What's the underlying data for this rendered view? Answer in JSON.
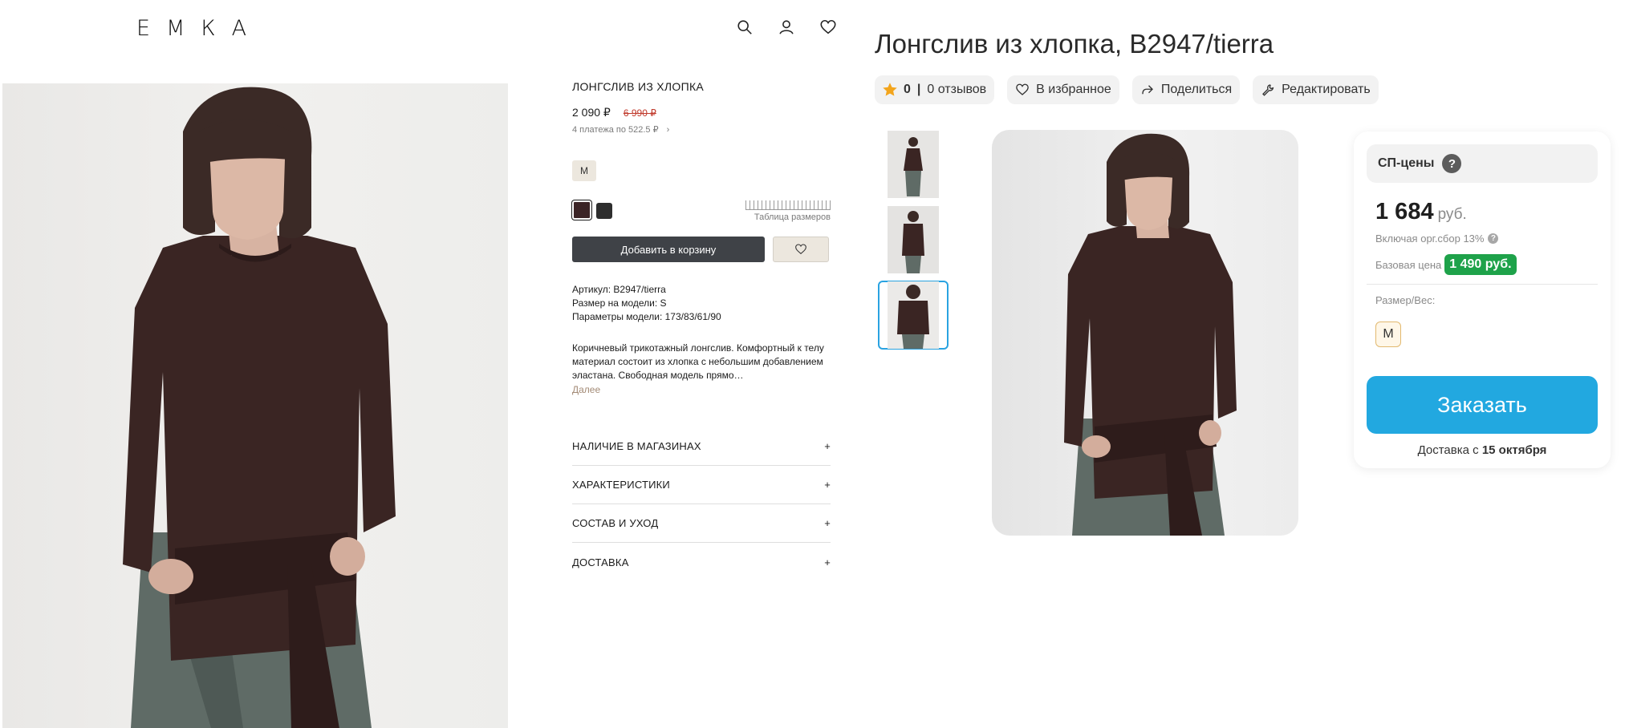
{
  "store": {
    "logo": [
      "Е",
      "М",
      "К",
      "А"
    ],
    "header_icons": [
      "search-icon",
      "user-icon",
      "heart-icon"
    ],
    "product": {
      "title": "ЛОНГСЛИВ ИЗ ХЛОПКА",
      "price": "2 090 ₽",
      "old_price": "6 990 ₽",
      "installments": "4 платежа по 522.5 ₽",
      "installments_arrow": "›",
      "size": "M",
      "swatch_colors": [
        "#3b2426",
        "#2e2e2e"
      ],
      "size_table": "Таблица размеров",
      "add_to_cart": "Добавить в корзину",
      "article": "Артикул: B2947/tierra",
      "model_size": "Размер на модели: S",
      "model_params": "Параметры модели: 173/83/61/90",
      "description": "Коричневый трикотажный лонгслив. Комфортный к телу материал состоит из хлопка с небольшим добавлением эластана. Свободная модель прямо…",
      "more": "Далее",
      "accordion": [
        {
          "label": "НАЛИЧИЕ В МАГАЗИНАХ"
        },
        {
          "label": "ХАРАКТЕРИСТИКИ"
        },
        {
          "label": "СОСТАВ И УХОД"
        },
        {
          "label": "ДОСТАВКА"
        }
      ],
      "accordion_icon": "+"
    }
  },
  "sp": {
    "title": "Лонгслив из хлопка, B2947/tierra",
    "rating": "0",
    "rating_sep": "|",
    "reviews": "0 отзывов",
    "favorite": "В избранное",
    "share": "Поделиться",
    "edit": "Редактировать",
    "card": {
      "heading": "СП-цены",
      "help": "?",
      "price": "1 684",
      "currency": "руб.",
      "fee": "Включая орг.сбор 13%",
      "base_label": "Базовая цена",
      "base_price": "1 490 руб.",
      "size_label": "Размер/Вес:",
      "size": "M",
      "order": "Заказать",
      "delivery_prefix": "Доставка с",
      "delivery_date": "15 октября"
    }
  },
  "colors": {
    "accent_blue": "#22a8e0",
    "green_badge": "#1ea24a",
    "cart_button": "#3f4247",
    "old_price": "#c0392b"
  }
}
